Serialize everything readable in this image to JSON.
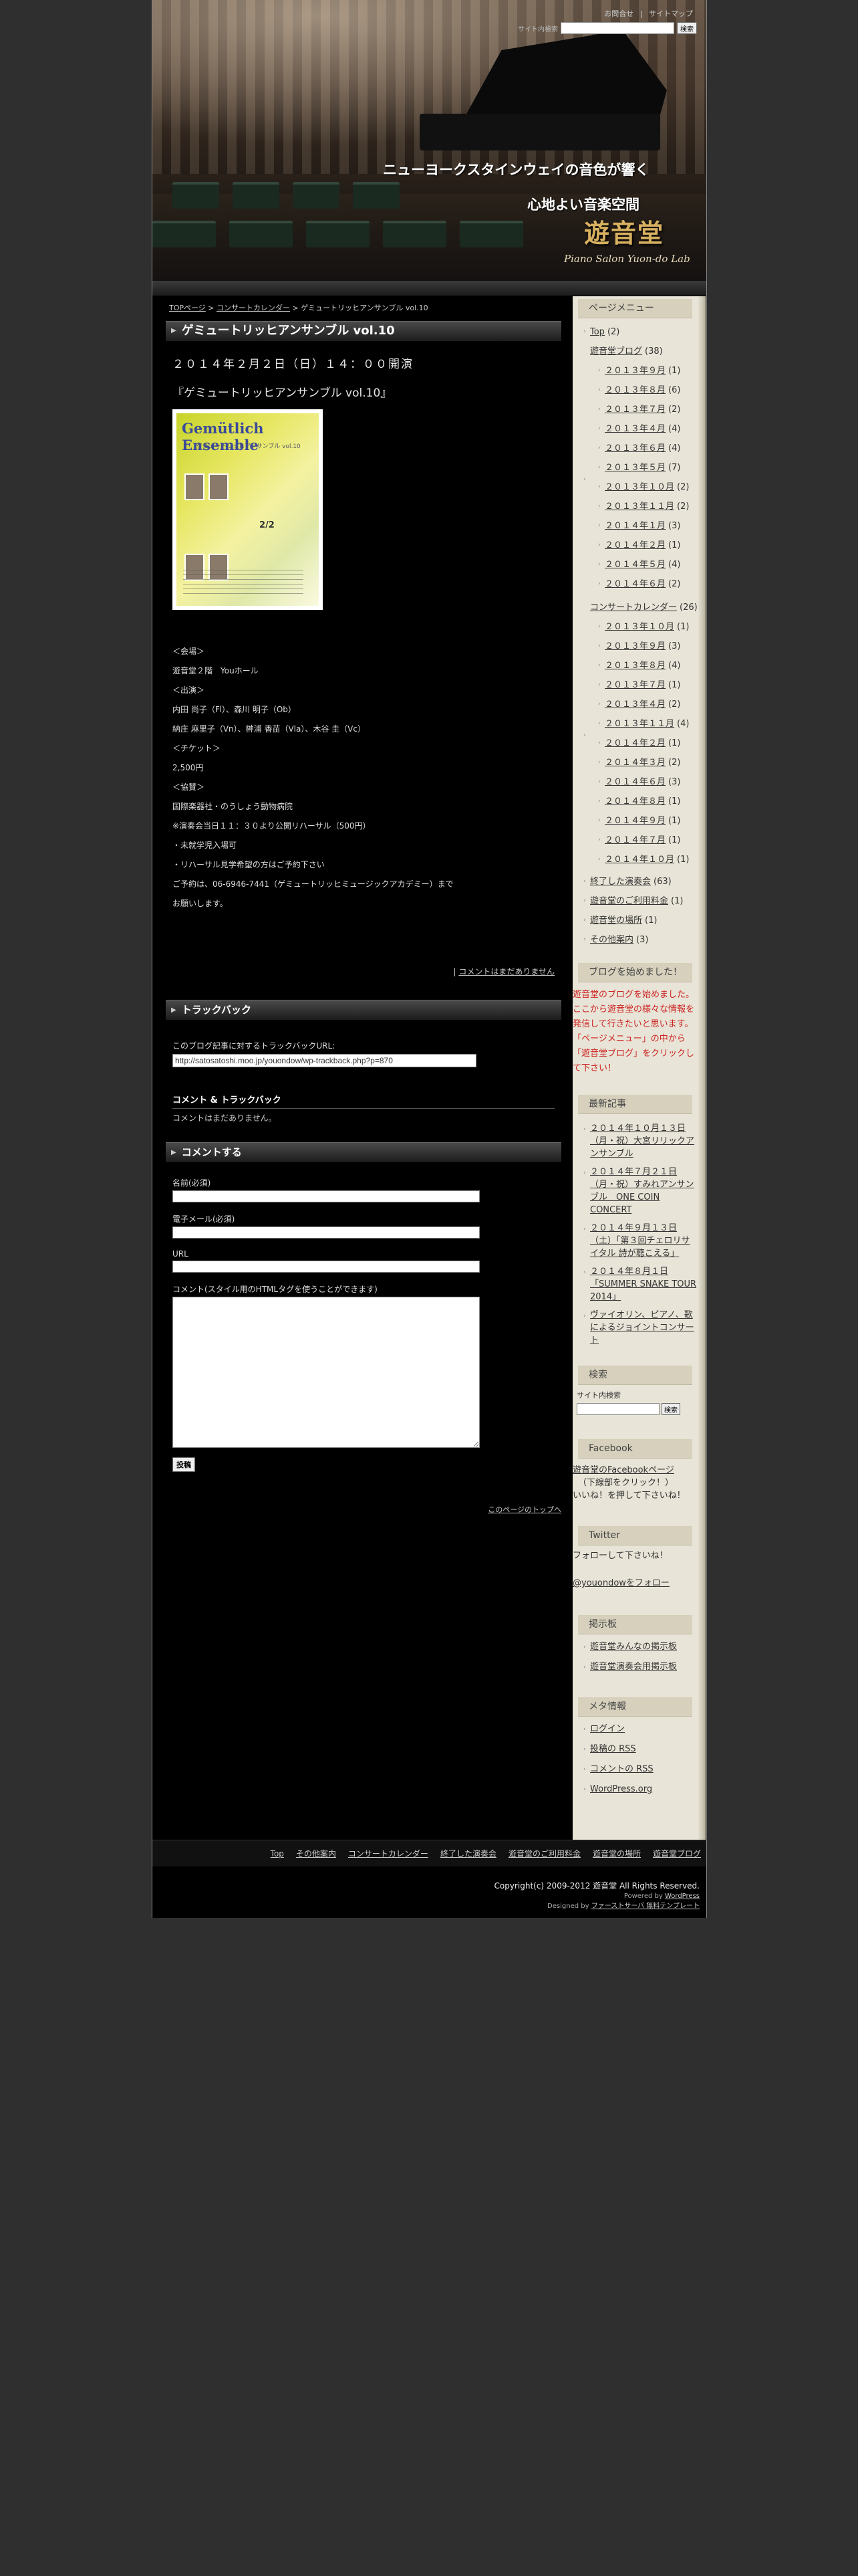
{
  "header": {
    "links": [
      "お問合せ",
      "サイトマップ"
    ],
    "search_label": "サイト内検索",
    "search_button": "検索",
    "tagline_1": "ニューヨークスタインウェイの音色が響く",
    "tagline_2": "心地よい音楽空間",
    "logo": "遊音堂",
    "logo_sub": "Piano Salon Yuon-do Lab"
  },
  "breadcrumb": {
    "home": "TOPページ",
    "sep": ">",
    "category": "コンサートカレンダー",
    "current": "ゲミュートリッヒアンサンブル vol.10"
  },
  "post": {
    "title": "ゲミュートリッヒアンサンブル vol.10",
    "date_line": "２０１４年２月２日（日）１４：００開演",
    "subtitle": "『ゲミュートリッヒアンサンブル vol.10』",
    "flyer": {
      "title": "Gemütlich Ensemble",
      "sub": "ゲミュートリッヒアンサンブル vol.10",
      "date": "2/2"
    },
    "info": [
      "＜会場＞",
      "遊音堂２階　Youホール",
      "＜出演＞",
      "内田 尚子（Fl）、森川 明子（Ob）",
      "納庄 麻里子（Vn）、榊浦 香苗（Vla）、木谷 圭（Vc）",
      "＜チケット＞",
      "2,500円",
      "＜協賛＞",
      "国際楽器社・のうしょう動物病院",
      "※演奏会当日１１：３０より公開リハーサル（500円）",
      "・未就学児入場可",
      "・リハーサル見学希望の方はご予約下さい",
      "ご予約は、06-6946-7441（ゲミュートリッヒミュージックアカデミー）まで",
      "お願いします。"
    ],
    "comment_link_prefix": "|",
    "comment_link": "コメントはまだありません"
  },
  "trackback": {
    "title": "トラックバック",
    "text": "このブログ記事に対するトラックバックURL:",
    "url": "http://satosatoshi.moo.jp/youondow/wp-trackback.php?p=870",
    "ct_head": "コメント & トラックバック",
    "ct_none": "コメントはまだありません。"
  },
  "comment_form": {
    "title": "コメントする",
    "name_label": "名前(必須)",
    "email_label": "電子メール(必須)",
    "url_label": "URL",
    "comment_label": "コメント(スタイル用のHTMLタグを使うことができます)",
    "submit": "投稿",
    "to_top": "このページのトップへ"
  },
  "sidebar": {
    "menu_title": "ページメニュー",
    "top": {
      "label": "Top",
      "count": "(2)"
    },
    "blog": {
      "label": "遊音堂ブログ",
      "count": "(38)"
    },
    "blog_months": [
      {
        "label": "２０１３年９月",
        "count": "(1)"
      },
      {
        "label": "２０１３年８月",
        "count": "(6)"
      },
      {
        "label": "２０１３年７月",
        "count": "(2)"
      },
      {
        "label": "２０１３年４月",
        "count": "(4)"
      },
      {
        "label": "２０１３年６月",
        "count": "(4)"
      },
      {
        "label": "２０１３年５月",
        "count": "(7)"
      },
      {
        "label": "２０１３年１０月",
        "count": "(2)"
      },
      {
        "label": "２０１３年１１月",
        "count": "(2)"
      },
      {
        "label": "２０１４年１月",
        "count": "(3)"
      },
      {
        "label": "２０１４年２月",
        "count": "(1)"
      },
      {
        "label": "２０１４年５月",
        "count": "(4)"
      },
      {
        "label": "２０１４年６月",
        "count": "(2)"
      }
    ],
    "calendar": {
      "label": "コンサートカレンダー",
      "count": "(26)"
    },
    "calendar_months": [
      {
        "label": "２０１３年１０月",
        "count": "(1)"
      },
      {
        "label": "２０１３年９月",
        "count": "(3)"
      },
      {
        "label": "２０１３年８月",
        "count": "(4)"
      },
      {
        "label": "２０１３年７月",
        "count": "(1)"
      },
      {
        "label": "２０１３年４月",
        "count": "(2)"
      },
      {
        "label": "２０１３年１１月",
        "count": "(4)"
      },
      {
        "label": "２０１４年２月",
        "count": "(1)"
      },
      {
        "label": "２０１４年３月",
        "count": "(2)"
      },
      {
        "label": "２０１４年６月",
        "count": "(3)"
      },
      {
        "label": "２０１４年８月",
        "count": "(1)"
      },
      {
        "label": "２０１４年９月",
        "count": "(1)"
      },
      {
        "label": "２０１４年７月",
        "count": "(1)"
      },
      {
        "label": "２０１４年１０月",
        "count": "(1)"
      }
    ],
    "others": [
      {
        "label": "終了した演奏会",
        "count": "(63)"
      },
      {
        "label": "遊音堂のご利用料金",
        "count": "(1)"
      },
      {
        "label": "遊音堂の場所",
        "count": "(1)"
      },
      {
        "label": "その他案内",
        "count": "(3)"
      }
    ],
    "blog_start_title": "ブログを始めました！",
    "blog_start_text_1": "遊音堂のブログを始めました。ここから遊音堂の様々な情報を発信して行きたいと思います。",
    "blog_start_text_2": "「ページメニュー」の中から「遊音堂ブログ」をクリックして下さい！",
    "recent_title": "最新記事",
    "recent": [
      "２０１４年１０月１３日（月・祝）大宮リリックアンサンブル",
      "２０１４年７月２１日（月・祝）すみれアンサンブル　ONE COIN CONCERT",
      "２０１４年９月１３日（土）「第３回チェロリサイタル 詩が聴こえる」",
      "２０１４年８月１日「SUMMER SNAKE TOUR 2014」",
      "ヴァイオリン、ピアノ、歌によるジョイントコンサート"
    ],
    "search_title": "検索",
    "search_label": "サイト内検索",
    "search_button": "検索",
    "facebook_title": "Facebook",
    "facebook_link": "遊音堂のFacebookページ",
    "facebook_note": "（下線部をクリック！）",
    "facebook_like": "いいね！を押して下さいね！",
    "twitter_title": "Twitter",
    "twitter_text": "フォローして下さいね！",
    "twitter_link": "@youondowをフォロー",
    "board_title": "掲示板",
    "board": [
      "遊音堂みんなの掲示板",
      "遊音堂演奏会用掲示板"
    ],
    "meta_title": "メタ情報",
    "meta": [
      "ログイン",
      "投稿の RSS",
      "コメントの RSS",
      "WordPress.org"
    ]
  },
  "footer": {
    "nav": [
      "Top",
      "その他案内",
      "コンサートカレンダー",
      "終了した演奏会",
      "遊音堂のご利用料金",
      "遊音堂の場所",
      "遊音堂ブログ"
    ],
    "copyright": "Copyright(c) 2009-2012 遊音堂 All Rights Reserved.",
    "powered_prefix": "Powered by",
    "powered_link": "WordPress",
    "designed_prefix": "Designed by",
    "designed_link": "ファーストサーバ 無料テンプレート"
  }
}
